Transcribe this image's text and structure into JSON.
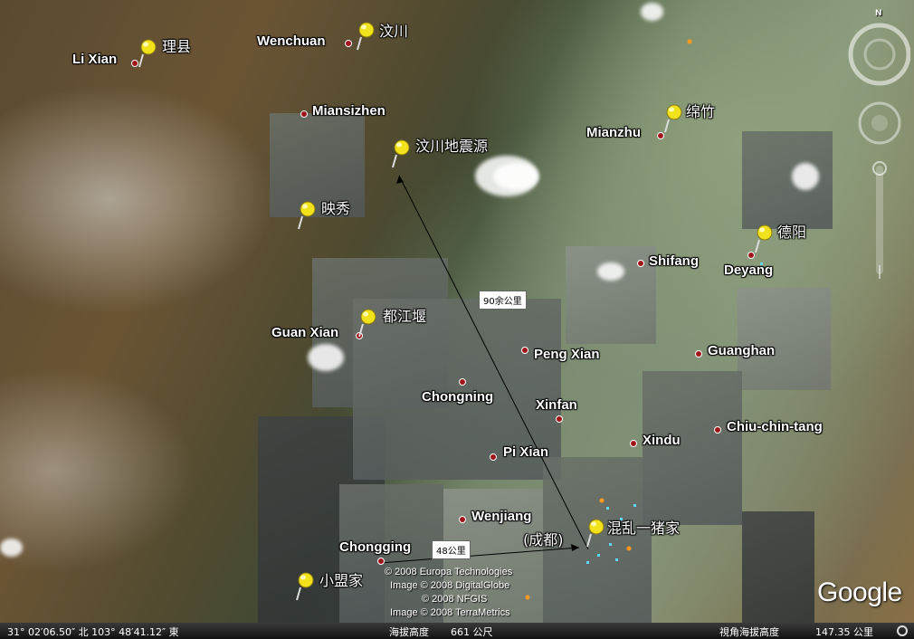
{
  "map": {
    "cities": [
      {
        "id": "li-xian",
        "label": "Li Xian"
      },
      {
        "id": "wenchuan",
        "label": "Wenchuan"
      },
      {
        "id": "miansizhen",
        "label": "Miansizhen"
      },
      {
        "id": "mianzhu",
        "label": "Mianzhu"
      },
      {
        "id": "shifang",
        "label": "Shifang"
      },
      {
        "id": "deyang",
        "label": "Deyang"
      },
      {
        "id": "guan-xian",
        "label": "Guan Xian"
      },
      {
        "id": "peng-xian",
        "label": "Peng Xian"
      },
      {
        "id": "guanghan",
        "label": "Guanghan"
      },
      {
        "id": "chongning",
        "label": "Chongning"
      },
      {
        "id": "xinfan",
        "label": "Xinfan"
      },
      {
        "id": "chiu-chin-tang",
        "label": "Chiu-chin-tang"
      },
      {
        "id": "xindu",
        "label": "Xindu"
      },
      {
        "id": "pi-xian",
        "label": "Pi Xian"
      },
      {
        "id": "wenjiang",
        "label": "Wenjiang"
      },
      {
        "id": "chongqing",
        "label": "Chongging"
      }
    ],
    "placemarks": [
      {
        "id": "lixian",
        "label": "理县"
      },
      {
        "id": "wenchuan",
        "label": "汶川"
      },
      {
        "id": "epicenter",
        "label": "汶川地震源"
      },
      {
        "id": "yingxiu",
        "label": "映秀"
      },
      {
        "id": "mianzhu",
        "label": "绵竹"
      },
      {
        "id": "deyang",
        "label": "德阳"
      },
      {
        "id": "dujiangyan",
        "label": "都江堰"
      },
      {
        "id": "chengdu",
        "label": "混乱一猪家"
      },
      {
        "id": "chengdu-sub",
        "label": "(成都)"
      },
      {
        "id": "xiaomeng",
        "label": "小盟家"
      }
    ],
    "distances": [
      {
        "id": "d90",
        "label": "90余公里"
      },
      {
        "id": "d48",
        "label": "48公里"
      }
    ],
    "copyright": [
      "© 2008 Europa Technologies",
      "Image © 2008 DigitalGlobe",
      "© 2008 NFGIS",
      "Image © 2008 TerraMetrics"
    ],
    "logo": "Google",
    "compass_north": "N"
  },
  "statusbar": {
    "coords": "31° 02′06.50″ 北  103° 48′41.12″ 東",
    "elevation_label": "海拔高度",
    "elevation_value": "661 公尺",
    "eye_alt_label": "視角海拔高度",
    "eye_alt_value": "147.35 公里"
  },
  "colors": {
    "pin": "#f2e21b",
    "city_dot": "#a0151a",
    "status_bg": "#1a1a1a"
  }
}
